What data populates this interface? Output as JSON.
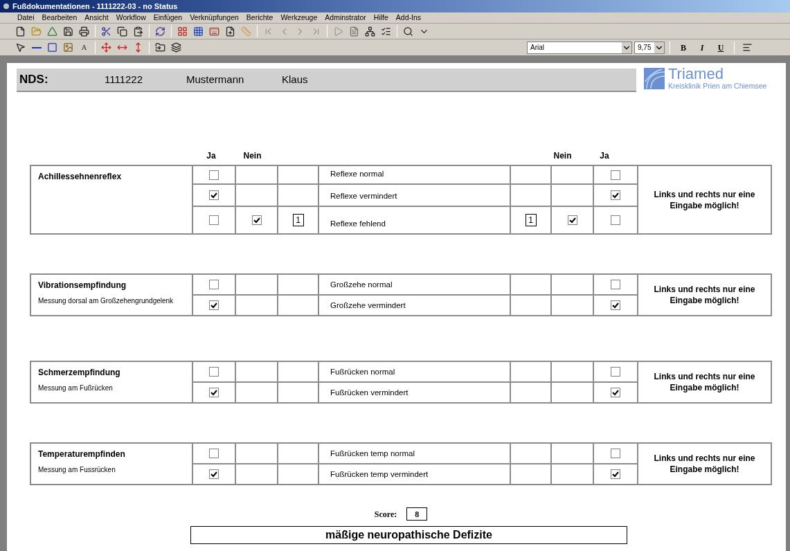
{
  "window": {
    "title": "Fußdokumentationen - 1111222-03 - no Status"
  },
  "menu": [
    "Datei",
    "Bearbeiten",
    "Ansicht",
    "Workflow",
    "Einfügen",
    "Verknüpfungen",
    "Berichte",
    "Werkzeuge",
    "Adminstrator",
    "Hilfe",
    "Add-Ins"
  ],
  "format_bar": {
    "text_tool": "A",
    "font": "Arial",
    "size": "9,75",
    "bold": "B",
    "italic": "I",
    "underline": "U"
  },
  "header": {
    "label": "NDS:",
    "id": "1111222",
    "last_name": "Mustermann",
    "first_name": "Klaus"
  },
  "logo": {
    "name": "Triamed",
    "subtitle": "Kreisklinik Prien am Chiemsee"
  },
  "column_headers": {
    "left_ja": "Ja",
    "left_nein": "Nein",
    "right_nein": "Nein",
    "right_ja": "Ja"
  },
  "sections": [
    {
      "title": "Achillessehnenreflex",
      "note": "Links und rechts nur eine Eingabe möglich!",
      "rows": [
        {
          "label": "Reflexe normal",
          "left_ja": false,
          "right_ja": false
        },
        {
          "label": "Reflexe vermindert",
          "left_ja": true,
          "right_ja": true
        },
        {
          "label": "Reflexe fehlend",
          "left_ja": false,
          "left_nein": true,
          "left_count": "1",
          "right_count": "1",
          "right_nein": true,
          "right_ja": false
        }
      ]
    },
    {
      "title": "Vibrationsempfindung",
      "subtitle": "Messung dorsal am Großzehengrundgelenk",
      "note": "Links und rechts nur eine Eingabe möglich!",
      "rows": [
        {
          "label": "Großzehe normal",
          "left_ja": false,
          "right_ja": false
        },
        {
          "label": "Großzehe vermindert",
          "left_ja": true,
          "right_ja": true
        }
      ]
    },
    {
      "title": "Schmerzempfindung",
      "subtitle": "Messung am Fußrücken",
      "note": "Links und rechts nur eine Eingabe möglich!",
      "rows": [
        {
          "label": "Fußrücken normal",
          "left_ja": false,
          "right_ja": false
        },
        {
          "label": "Fußrücken vermindert",
          "left_ja": true,
          "right_ja": true
        }
      ]
    },
    {
      "title": "Temperaturempfinden",
      "subtitle": "Messung am Fussrücken",
      "note": "Links und rechts nur eine Eingabe möglich!",
      "rows": [
        {
          "label": "Fußrücken temp normal",
          "left_ja": false,
          "right_ja": false
        },
        {
          "label": "Fußrücken temp vermindert",
          "left_ja": true,
          "right_ja": true
        }
      ]
    }
  ],
  "score": {
    "label": "Score:",
    "value": "8"
  },
  "result": "mäßige neuropathische Defizite"
}
